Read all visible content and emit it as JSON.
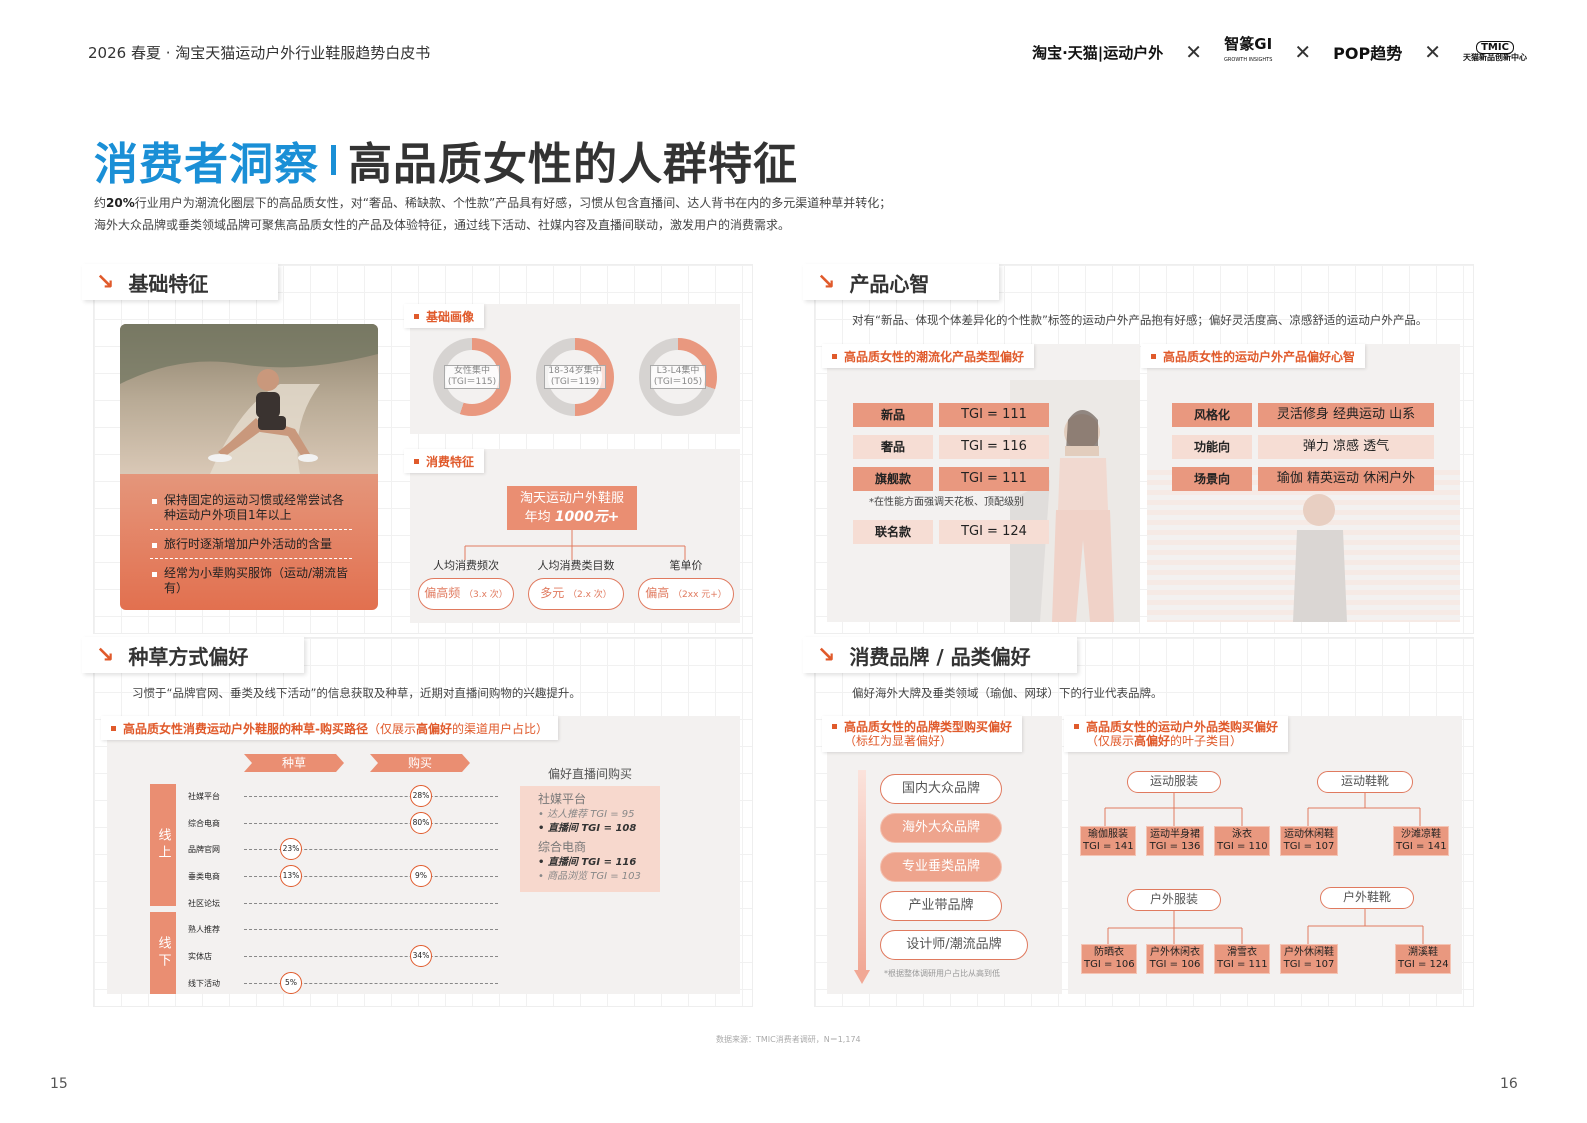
{
  "header": {
    "title": "2026 春夏 · 淘宝天猫运动户外行业鞋服趋势白皮书",
    "logos": [
      "淘宝·天猫|运动户外",
      "智篆GI",
      "POP趋势",
      "天猫新品创新中心"
    ],
    "logo_sub": "GROWTH INSIGHTS",
    "tmic": "TMIC",
    "sep": "✕"
  },
  "title": {
    "blue": "消费者洞察",
    "black": "高品质女性的人群特征"
  },
  "intro": {
    "pre": "约",
    "bold": "20%",
    "line1": "行业用户为潮流化圈层下的高品质女性，对“奢品、稀缺款、个性款”产品具有好感，习惯从包含直播间、达人背书在内的多元渠道种草并转化；",
    "line2": "海外大众品牌或垂类领域品牌可聚焦高品质女性的产品及体验特征，通过线下活动、社媒内容及直播间联动，激发用户的消费需求。"
  },
  "arrow": "↘",
  "basic": {
    "title": "基础特征",
    "bullets": [
      "保持固定的运动习惯或经常尝试各种运动户外项目1年以上",
      "旅行时逐渐增加户外活动的含量",
      "经常为小辈购买服饰（运动/潮流皆有）"
    ],
    "portrait_tab": "基础画像",
    "donuts": [
      {
        "line1": "女性集中",
        "line2": "(TGI＝115)",
        "share": 0.55
      },
      {
        "line1": "18-34岁集中",
        "line2": "(TGI＝119)",
        "share": 0.5
      },
      {
        "line1": "L3-L4集中",
        "line2": "(TGI＝105)",
        "share": 0.3
      }
    ],
    "consume_tab": "消费特征",
    "box_line1": "淘天运动户外鞋服",
    "box_line2": "年均",
    "box_value": "1000元+",
    "metrics": [
      {
        "label": "人均消费频次",
        "value": "偏高频",
        "note": "（3.x 次）"
      },
      {
        "label": "人均消费类目数",
        "value": "多元",
        "note": "（2.x 次）"
      },
      {
        "label": "笔单价",
        "value": "偏高",
        "note": "（2xx 元+）"
      }
    ]
  },
  "product": {
    "title": "产品心智",
    "desc": "对有“新品、体现个体差异化的个性款”标签的运动户外产品抱有好感；偏好灵活度高、凉感舒适的运动户外产品。",
    "left_tab": "高品质女性的潮流化产品类型偏好",
    "rows": [
      {
        "k": "新品",
        "v": "TGI = 111",
        "hl": true
      },
      {
        "k": "奢品",
        "v": "TGI = 116",
        "hl": false
      },
      {
        "k": "旗舰款",
        "v": "TGI = 111",
        "hl": true
      },
      {
        "k": "联名款",
        "v": "TGI = 124",
        "hl": false
      }
    ],
    "footnote": "*在性能方面强调天花板、顶配级别",
    "right_tab": "高品质女性的运动户外产品偏好心智",
    "mind": [
      {
        "k": "风格化",
        "v": "灵活修身  经典运动  山系",
        "hl": true
      },
      {
        "k": "功能向",
        "v": "弹力  凉感  透气",
        "hl": false
      },
      {
        "k": "场景向",
        "v": "瑜伽  精英运动  休闲户外",
        "hl": true
      }
    ]
  },
  "seed": {
    "title": "种草方式偏好",
    "desc": "习惯于“品牌官网、垂类及线下活动”的信息获取及种草，近期对直播间购物的兴趣提升。",
    "tab": "高品质女性消费运动户外鞋服的种草-购买路径",
    "tab_note_pre": "（仅展示",
    "tab_note_bold": "高偏好",
    "tab_note_post": "的渠道用户占比）",
    "head_seed": "种草",
    "head_buy": "购买",
    "online": "线上",
    "offline": "线下",
    "channels": [
      {
        "name": "社媒平台",
        "seed": null,
        "buy": "28%"
      },
      {
        "name": "综合电商",
        "seed": null,
        "buy": "80%"
      },
      {
        "name": "品牌官网",
        "seed": "23%",
        "buy": null
      },
      {
        "name": "垂类电商",
        "seed": "13%",
        "buy": "9%"
      },
      {
        "name": "社区论坛",
        "seed": null,
        "buy": null
      },
      {
        "name": "熟人推荐",
        "seed": null,
        "buy": null
      },
      {
        "name": "实体店",
        "seed": null,
        "buy": "34%"
      },
      {
        "name": "线下活动",
        "seed": "5%",
        "buy": null
      }
    ],
    "live_title": "偏好直播间购买",
    "live_groups": [
      {
        "name": "社媒平台",
        "items": [
          {
            "t": "达人推荐 TGI = 95",
            "b": false
          },
          {
            "t": "直播间 TGI = 108",
            "b": true
          }
        ]
      },
      {
        "name": "综合电商",
        "items": [
          {
            "t": "直播间 TGI = 116",
            "b": true
          },
          {
            "t": "商品浏览 TGI = 103",
            "b": false
          }
        ]
      }
    ]
  },
  "brand": {
    "title": "消费品牌 / 品类偏好",
    "desc": "偏好海外大牌及垂类领域（瑜伽、网球）下的行业代表品牌。",
    "left_tab": "高品质女性的品牌类型购买偏好",
    "left_note": "（标红为显著偏好）",
    "brands": [
      {
        "name": "国内大众品牌",
        "hl": false
      },
      {
        "name": "海外大众品牌",
        "hl": true
      },
      {
        "name": "专业垂类品牌",
        "hl": true
      },
      {
        "name": "产业带品牌",
        "hl": false
      },
      {
        "name": "设计师/潮流品牌",
        "hl": false
      }
    ],
    "left_foot": "*根据整体调研用户占比从高到低",
    "right_tab": "高品质女性的运动户外品类购买偏好",
    "right_note_pre": "（仅展示",
    "right_note_bold": "高偏好",
    "right_note_post": "的叶子类目）",
    "groups": [
      {
        "name": "运动服装",
        "leaves": [
          {
            "n": "瑜伽服装",
            "t": "TGI = 141"
          },
          {
            "n": "运动半身裙",
            "t": "TGI = 136"
          },
          {
            "n": "泳衣",
            "t": "TGI = 110"
          }
        ]
      },
      {
        "name": "运动鞋靴",
        "leaves": [
          {
            "n": "运动休闲鞋",
            "t": "TGI = 107"
          },
          {
            "n": "沙滩凉鞋",
            "t": "TGI = 141"
          }
        ]
      },
      {
        "name": "户外服装",
        "leaves": [
          {
            "n": "防晒衣",
            "t": "TGI = 106"
          },
          {
            "n": "户外休闲衣",
            "t": "TGI = 106"
          },
          {
            "n": "滑雪衣",
            "t": "TGI = 111"
          }
        ]
      },
      {
        "name": "户外鞋靴",
        "leaves": [
          {
            "n": "户外休闲鞋",
            "t": "TGI = 107"
          },
          {
            "n": "溯溪鞋",
            "t": "TGI = 124"
          }
        ]
      }
    ]
  },
  "source": "数据来源：TMIC消费者调研，N＝1,174",
  "pages": {
    "left": "15",
    "right": "16"
  },
  "colors": {
    "accent": "#e05a2b",
    "blue": "#1a8fd6",
    "salmon": "#e9987f"
  }
}
